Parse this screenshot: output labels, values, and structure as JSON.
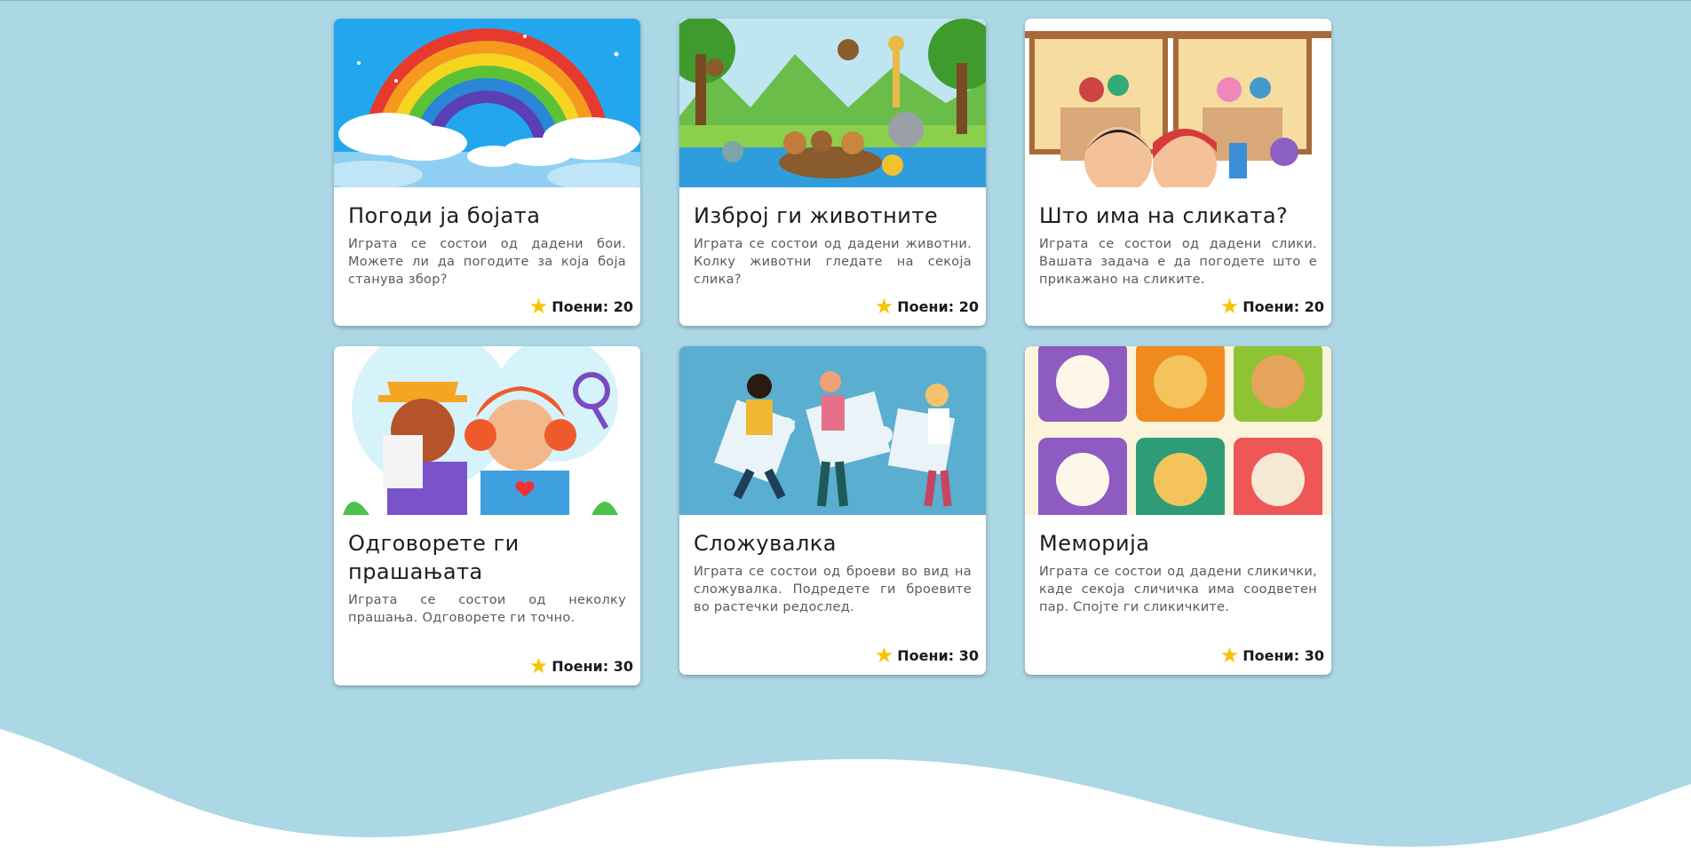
{
  "cards": [
    {
      "title": "Погоди ја бојата",
      "description": "Играта се состои од дадени бои. Можете ли да погодите за која боја станува збор?",
      "points": "Поени: 20",
      "image": "rainbow-illustration"
    },
    {
      "title": "Изброј ги животните",
      "description": "Играта се состои од дадени животни. Колку животни гледате на секоја слика?",
      "points": "Поени: 20",
      "image": "jungle-animals-illustration"
    },
    {
      "title": "Што има на сликата?",
      "description": "Играта се состои од дадени слики. Вашата задача е да погодете што е прикажано на сликите.",
      "points": "Поени: 20",
      "image": "kids-toys-illustration"
    },
    {
      "title": "Одговорете ги прашањата",
      "description": "Играта се состои од неколку прашања. Одговорете ги точно.",
      "points": "Поени: 30",
      "image": "kids-detective-illustration"
    },
    {
      "title": "Сложувалка",
      "description": "Играта се состои од броеви во вид на сложувалка. Подредете ги броевите во растечки редослед.",
      "points": "Поени: 30",
      "image": "puzzle-people-illustration"
    },
    {
      "title": "Меморија",
      "description": "Играта се состои од дадени сликички, каде секоја сличичка има соодветен пар. Спојте ги сликичките.",
      "points": "Поени: 30",
      "image": "memory-animal-cards-illustration"
    }
  ],
  "icons": {
    "points": "star-icon"
  },
  "colors": {
    "background": "#acd7e5",
    "card": "#ffffff",
    "star": "#f5c400"
  }
}
